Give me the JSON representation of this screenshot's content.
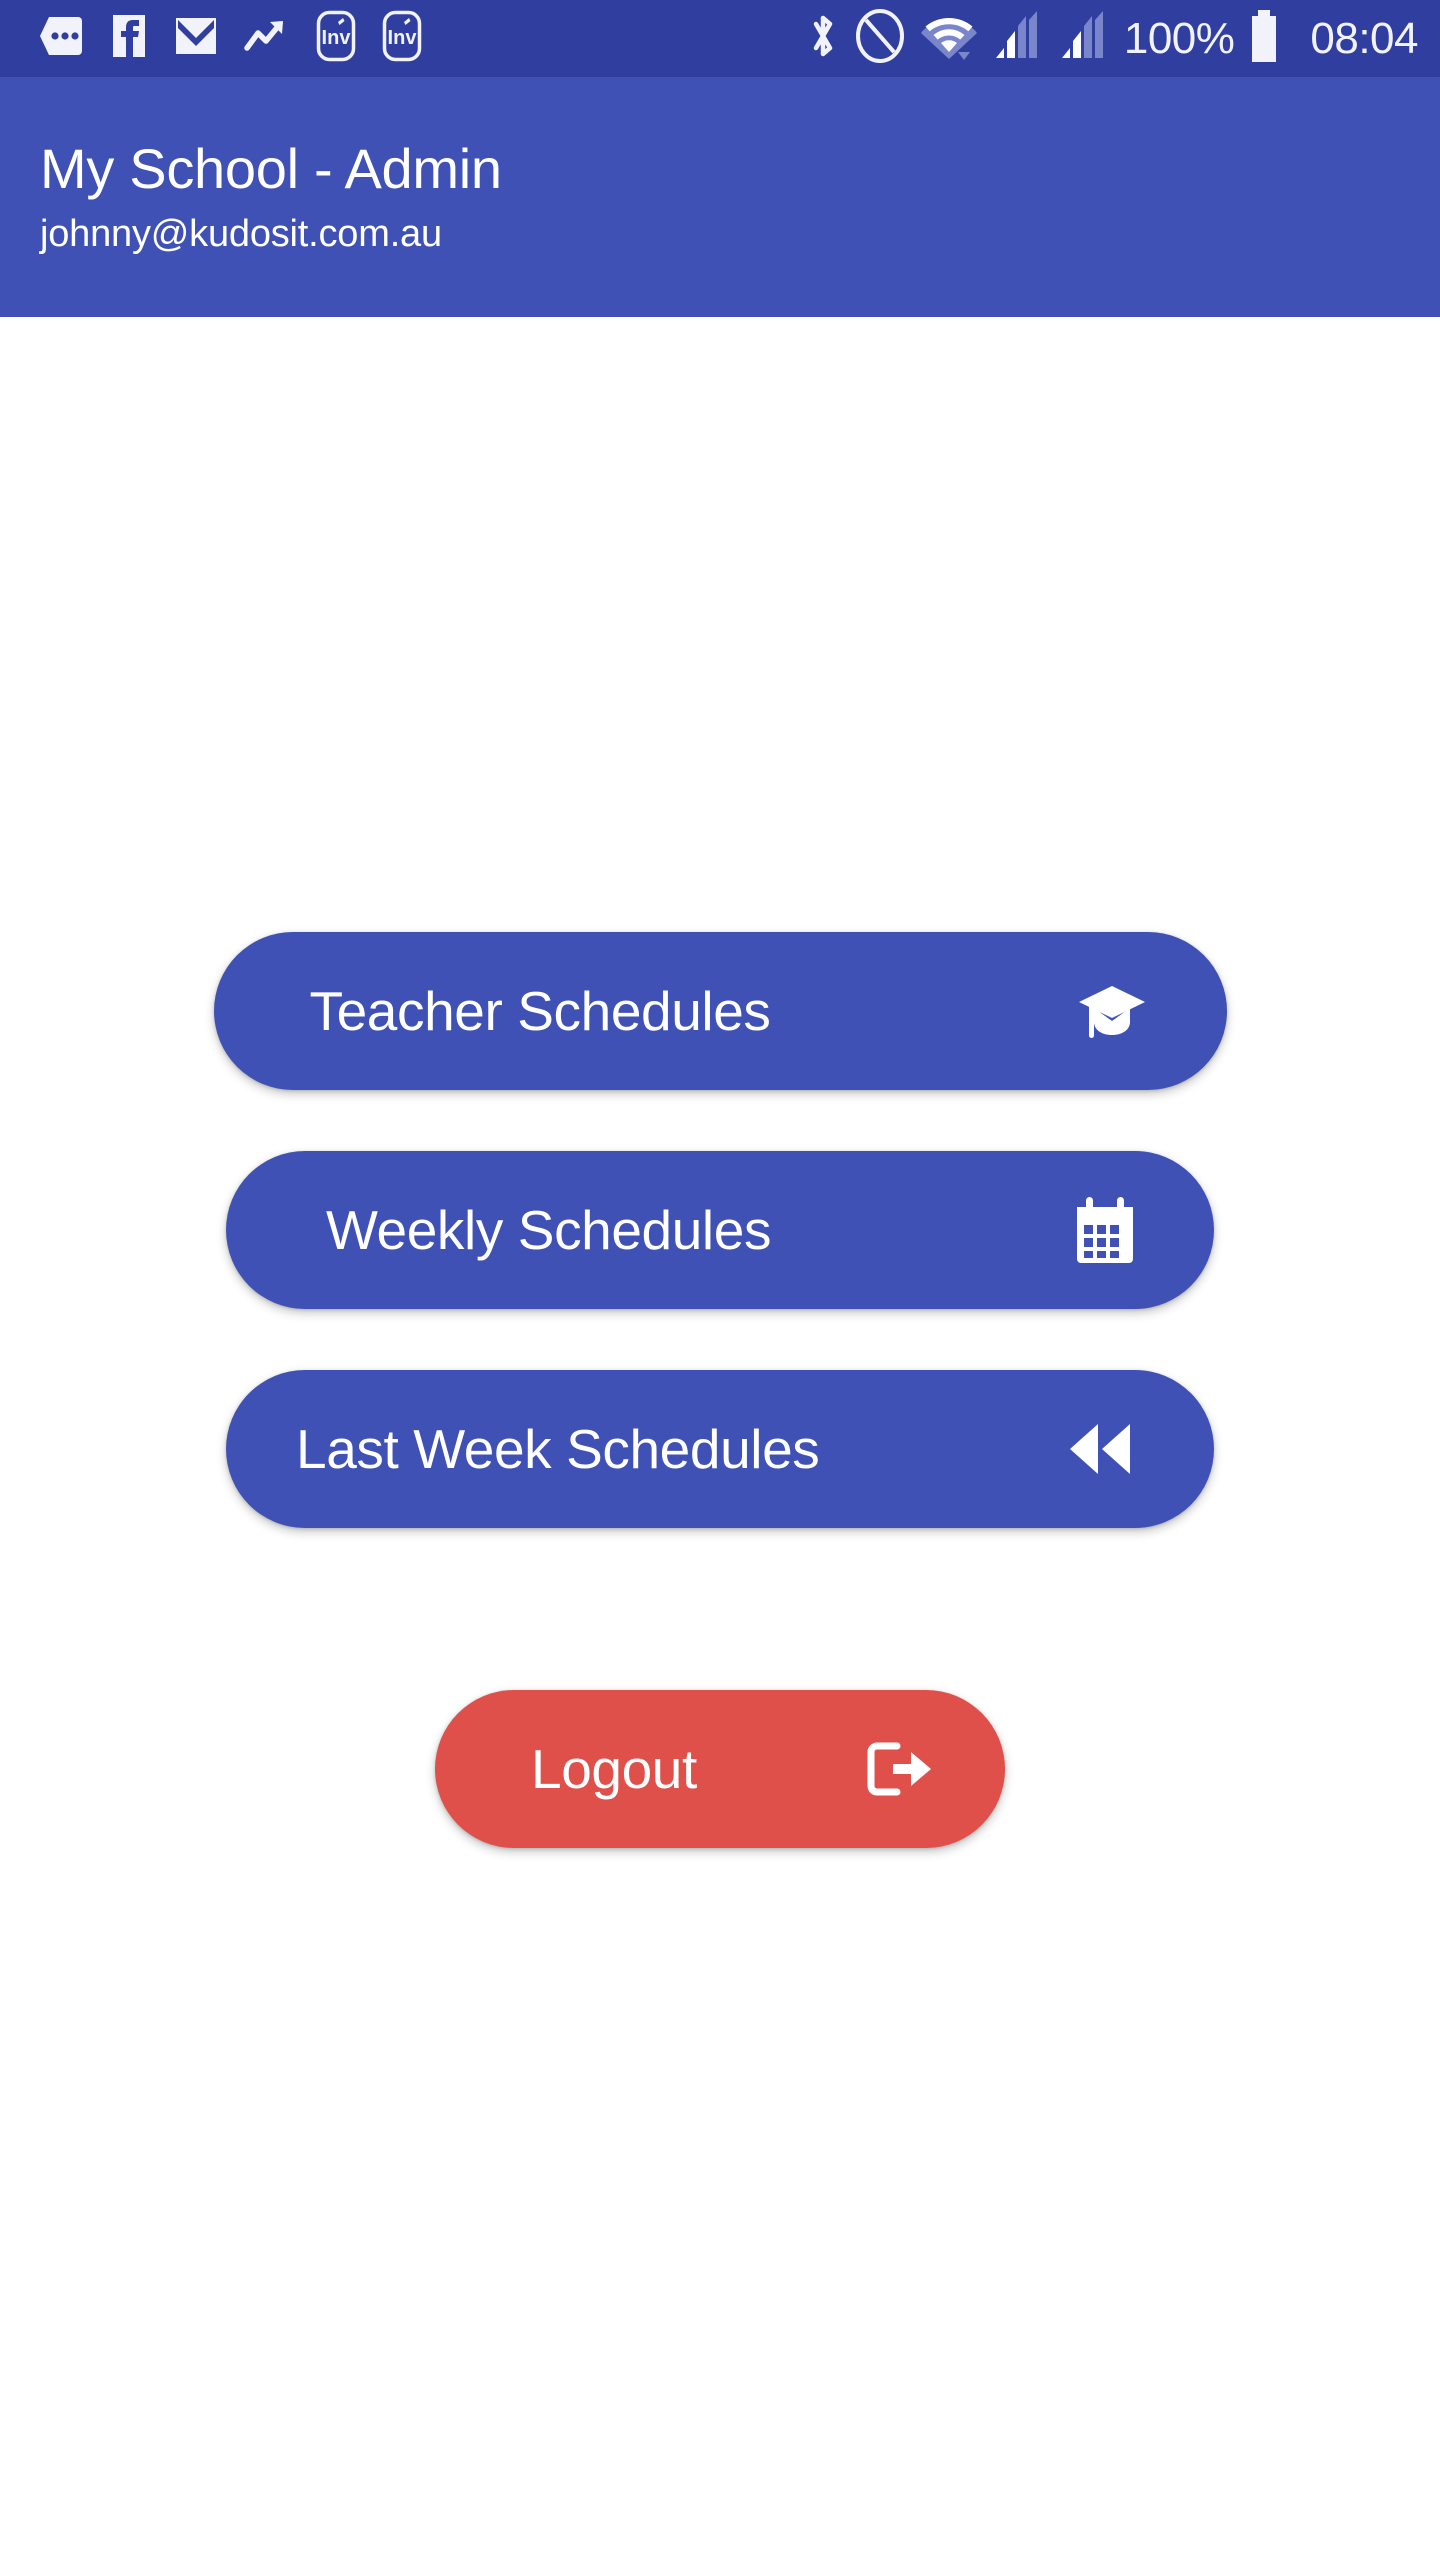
{
  "status_bar": {
    "background_color": "#303F9F",
    "left_icons": [
      {
        "name": "messages-icon",
        "label": "Messages"
      },
      {
        "name": "facebook-icon",
        "label": "Facebook"
      },
      {
        "name": "email-icon",
        "label": "Email"
      },
      {
        "name": "trending-up-icon",
        "label": "Trending"
      },
      {
        "name": "invoice-app-icon",
        "label": "Inv"
      },
      {
        "name": "invoice-app-icon-2",
        "label": "Inv"
      }
    ],
    "right_icons": [
      {
        "name": "bluetooth-icon",
        "label": "Bluetooth"
      },
      {
        "name": "do-not-disturb-icon",
        "label": "Do Not Disturb"
      },
      {
        "name": "wifi-icon",
        "label": "Wi-Fi"
      },
      {
        "name": "signal-sim1-icon",
        "label": "Signal SIM 1"
      },
      {
        "name": "signal-sim2-icon",
        "label": "Signal SIM 2"
      }
    ],
    "battery_percent": "100%",
    "time": "08:04"
  },
  "header": {
    "title": "My School - Admin",
    "email": "johnny@kudosit.com.au",
    "background_color": "#3F51B5"
  },
  "menu": {
    "buttons": [
      {
        "label": "Teacher Schedules",
        "icon": "graduation-cap-icon",
        "color": "#3F51B5"
      },
      {
        "label": "Weekly Schedules",
        "icon": "calendar-icon",
        "color": "#3F51B5"
      },
      {
        "label": "Last Week Schedules",
        "icon": "rewind-icon",
        "color": "#3F51B5"
      }
    ]
  },
  "logout": {
    "label": "Logout",
    "icon": "sign-out-icon",
    "color": "#DF504A"
  }
}
